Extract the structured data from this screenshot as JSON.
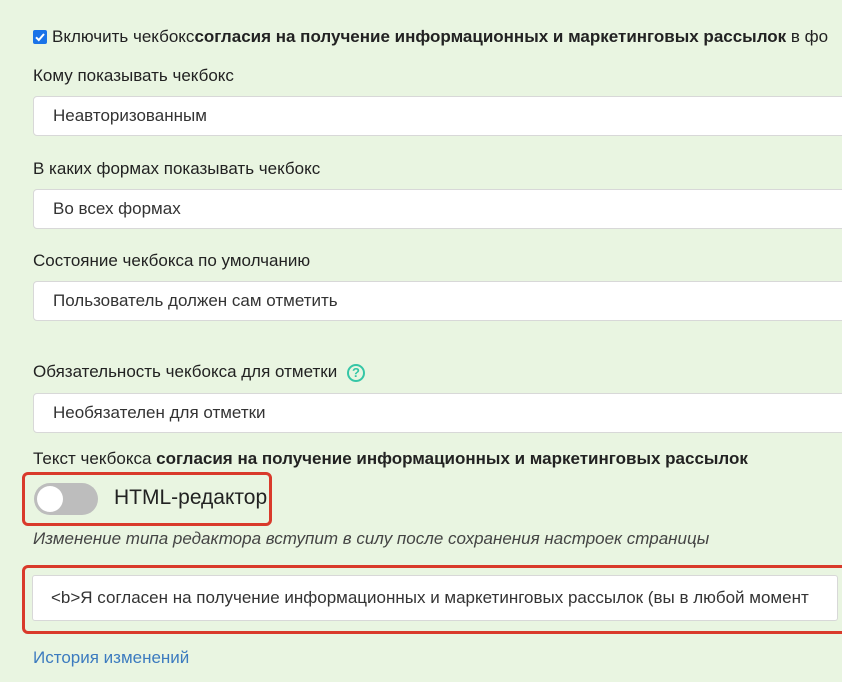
{
  "consent": {
    "enable_prefix": "Включить чекбокс ",
    "enable_bold": "согласия на получение информационных и маркетинговых рассылок",
    "enable_suffix": " в фо"
  },
  "who": {
    "label": "Кому показывать чекбокс",
    "value": "Неавторизованным"
  },
  "forms": {
    "label": "В каких формах показывать чекбокс",
    "value": "Во всех формах"
  },
  "default_state": {
    "label": "Состояние чекбокса по умолчанию",
    "value": "Пользователь должен сам отметить"
  },
  "required": {
    "label": "Обязательность чекбокса для отметки",
    "help_glyph": "?",
    "value": "Необязателен для отметки"
  },
  "text_section": {
    "label_prefix": "Текст чекбокса ",
    "label_bold": "согласия на получение информационных и маркетинговых рассылок"
  },
  "html_editor": {
    "label": "HTML-редактор",
    "enabled": false
  },
  "note": "Изменение типа редактора вступит в силу после сохранения настроек страницы",
  "checkbox_text": "<b>Я согласен на получение информационных и маркетинговых рассылок (вы в любой момент",
  "history_link": "История изменений",
  "colors": {
    "background": "#e9f5e1",
    "accent": "#1a73e8",
    "highlight": "#d93a2b",
    "link": "#3c7bbf",
    "help": "#35c6a6"
  }
}
